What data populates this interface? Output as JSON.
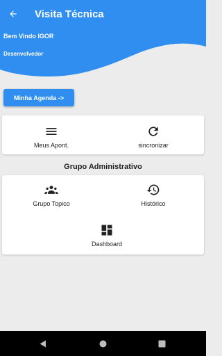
{
  "appbar": {
    "title": "Visita Técnica",
    "back_icon": "arrow-left-icon"
  },
  "header": {
    "welcome": "Bem Vindo IGOR",
    "role": "Desenvolvedor",
    "color": "#2f8eef"
  },
  "agenda_button": {
    "label": "Minha Agenda ->"
  },
  "card1": {
    "items": [
      {
        "label": "Meus Apont.",
        "icon": "menu-icon"
      },
      {
        "label": "sincronizar",
        "icon": "refresh-icon"
      }
    ]
  },
  "section": {
    "title": "Grupo Administrativo"
  },
  "card2": {
    "items": [
      {
        "label": "Grupo Topico",
        "icon": "group-icon"
      },
      {
        "label": "Histórico",
        "icon": "history-icon"
      },
      {
        "label": "Dashboard",
        "icon": "dashboard-icon"
      }
    ]
  },
  "navbar": {
    "icons": [
      "back-triangle-icon",
      "home-circle-icon",
      "recents-square-icon"
    ]
  }
}
